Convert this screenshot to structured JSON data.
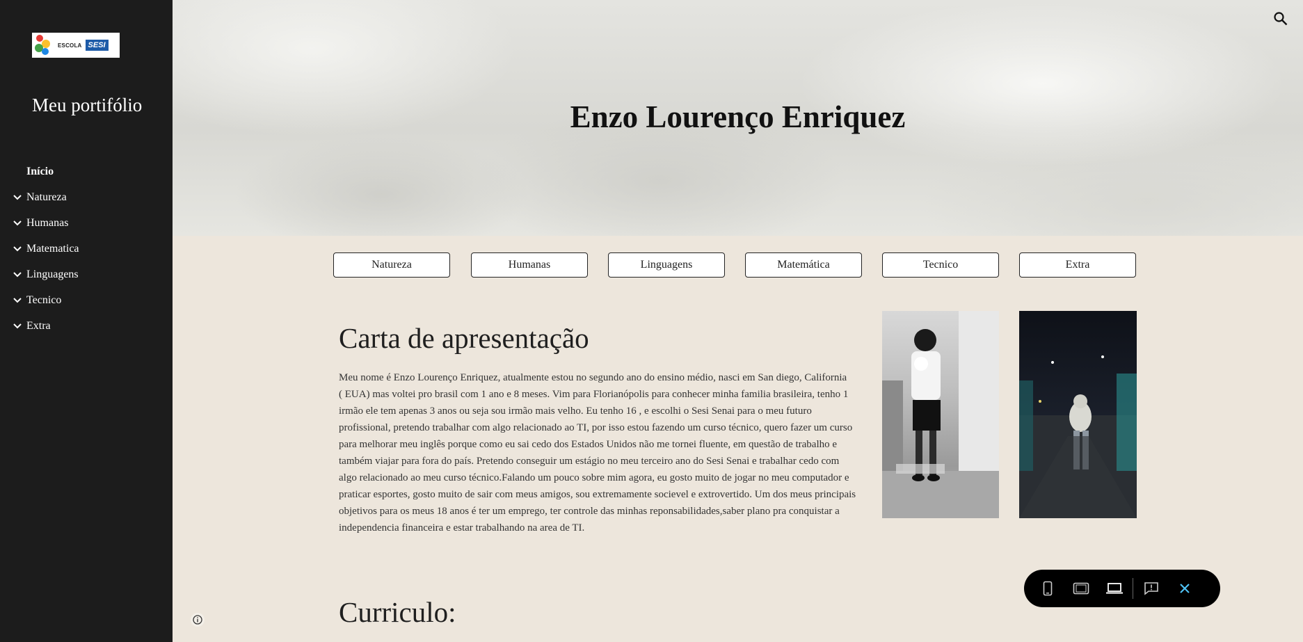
{
  "sidebar": {
    "logo": {
      "text": "ESCOLA",
      "brand": "SESI"
    },
    "site_title": "Meu portifólio",
    "home": "Início",
    "items": [
      {
        "label": "Natureza"
      },
      {
        "label": "Humanas"
      },
      {
        "label": "Matematica"
      },
      {
        "label": "Linguagens"
      },
      {
        "label": "Tecnico"
      },
      {
        "label": "Extra"
      }
    ]
  },
  "header": {
    "title": "Enzo Lourenço Enriquez"
  },
  "buttons": [
    {
      "label": "Natureza"
    },
    {
      "label": "Humanas"
    },
    {
      "label": "Linguagens"
    },
    {
      "label": "Matemática"
    },
    {
      "label": "Tecnico"
    },
    {
      "label": "Extra"
    }
  ],
  "main": {
    "heading1": "Carta de apresentação",
    "paragraph_lines": [
      "Meu nome é Enzo Lourenço Enriquez, atualmente estou no segundo ano do ensino médio, nasci em San diego, California",
      "( EUA)  mas voltei pro brasil com 1 ano e 8 meses. Vim para Florianópolis para conhecer minha familia brasileira, tenho 1",
      "irmão ele tem apenas 3 anos ou seja sou irmão mais velho. Eu tenho 16 , e escolhi o Sesi Senai para o meu futuro",
      "profissional, pretendo trabalhar com algo relacionado ao TI, por isso estou fazendo um curso técnico, quero fazer um curso",
      "para melhorar meu inglês porque como eu sai cedo dos Estados Unidos não me tornei fluente, em questão de trabalho e",
      "também viajar para fora do país. Pretendo conseguir um estágio no meu terceiro ano do Sesi Senai e trabalhar cedo com",
      "algo relacionado ao meu curso técnico.Falando um pouco sobre mim agora, eu gosto muito de jogar no meu computador e",
      "praticar esportes, gosto muito de sair com meus amigos, sou extremamente socievel e extrovertido. Um dos meus principais",
      "objetivos para os meus 18 anos é ter um emprego, ter controle das minhas reponsabilidades,saber plano pra conquistar a",
      "independencia financeira e estar trabalhando na area de TI."
    ],
    "heading2": "Curriculo:"
  },
  "colors": {
    "sidebar_bg": "#1c1c1c",
    "page_bg": "#ede6dc",
    "toolbar_accent": "#4fc3f7"
  },
  "icons": [
    "search-icon",
    "chevron-down-icon",
    "info-icon",
    "phone-icon",
    "tablet-icon",
    "laptop-icon",
    "feedback-icon",
    "close-icon"
  ]
}
